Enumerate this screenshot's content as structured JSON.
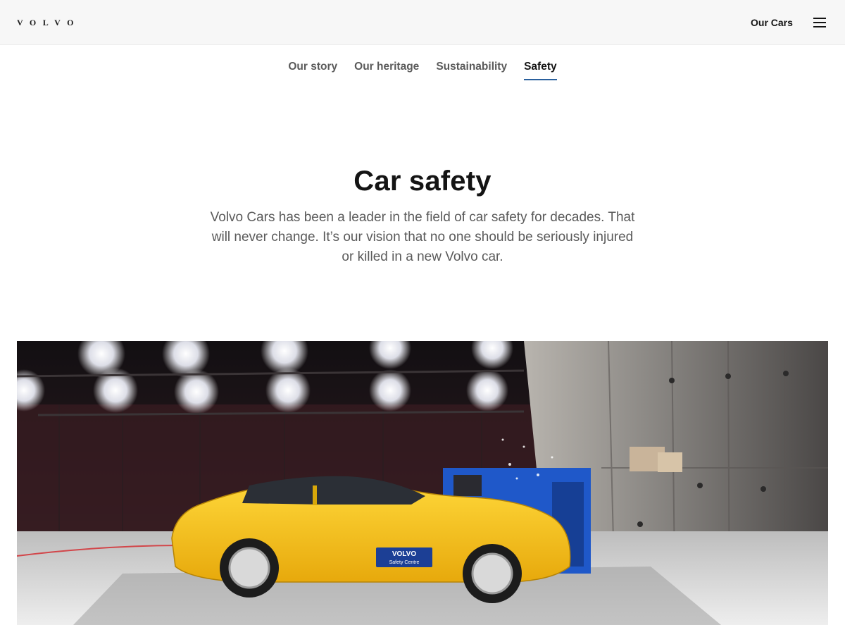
{
  "header": {
    "logo_text": "VOLVO",
    "our_cars_label": "Our Cars",
    "menu_icon": "hamburger-menu-icon"
  },
  "subnav": {
    "items": [
      {
        "label": "Our story",
        "active": false
      },
      {
        "label": "Our heritage",
        "active": false
      },
      {
        "label": "Sustainability",
        "active": false
      },
      {
        "label": "Safety",
        "active": true
      }
    ],
    "active_underline_color": "#2a609d"
  },
  "main": {
    "title": "Car safety",
    "intro": "Volvo Cars has been a leader in the field of car safety for decades. That will never change. It’s our vision that no one should be seriously injured or killed in a new Volvo car."
  },
  "hero_image": {
    "subject": "crash-test-photo",
    "badge_line1": "VOLVO",
    "badge_line2": "Safety Centre",
    "car_color": "#f4c514"
  }
}
